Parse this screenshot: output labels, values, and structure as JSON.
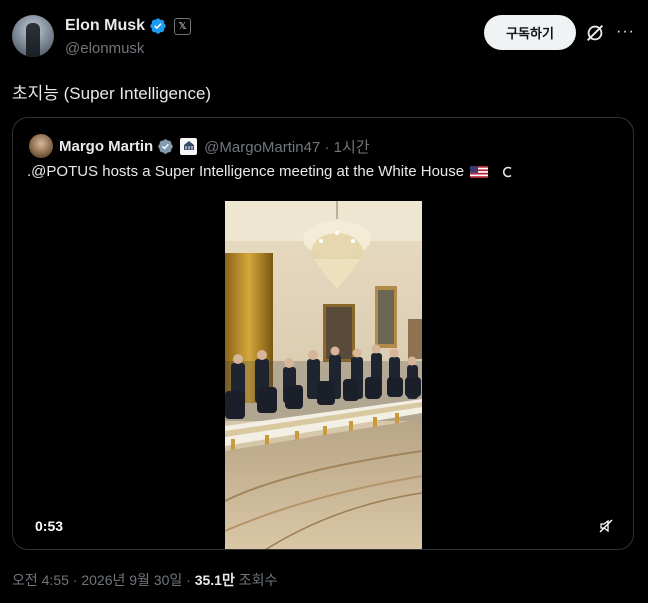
{
  "author": {
    "name": "Elon Musk",
    "handle": "@elonmusk",
    "verified_icon": "verified-badge-icon",
    "affiliation_label": "𝕏"
  },
  "actions": {
    "subscribe_label": "구독하기",
    "grok_icon": "grok-icon",
    "more_icon": "more-icon",
    "more_label": "···"
  },
  "tweet": {
    "text": "초지능 (Super Intelligence)"
  },
  "quoted": {
    "name": "Margo Martin",
    "handle_time": "@MargoMartin47 · 1시간",
    "text": ".@POTUS hosts a Super Intelligence meeting at the White House",
    "video": {
      "duration": "0:53",
      "mute_icon": "muted-speaker-icon"
    }
  },
  "meta": {
    "time_date": "오전 4:55 · 2026년 9월 30일 · ",
    "views_count": "35.1만",
    "views_label": " 조회수"
  },
  "colors": {
    "background": "#000000",
    "text_primary": "#e7e9ea",
    "text_secondary": "#71767b",
    "verified": "#1d9bf0",
    "border": "#2f3336"
  }
}
